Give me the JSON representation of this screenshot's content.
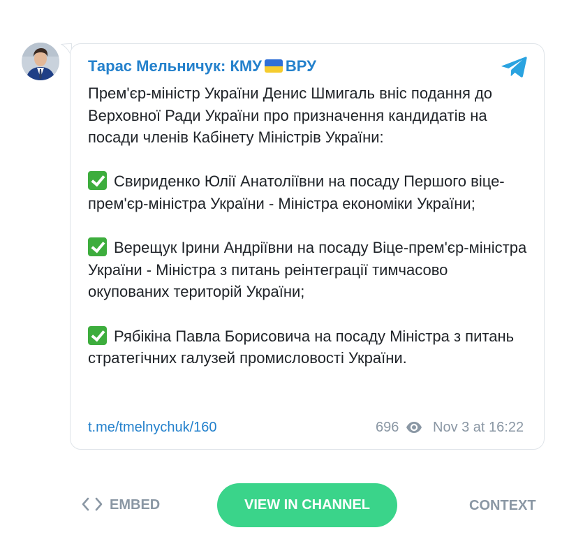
{
  "post": {
    "channel_name_part1": "Тарас Мельничук: КМУ",
    "channel_name_part2": "ВРУ",
    "flag_icon": "ukraine-flag-icon",
    "platform_icon": "telegram-icon",
    "paragraphs": [
      "Прем'єр-міністр України Денис Шмигаль вніс подання до Верховної Ради України про призначення кандидатів на посади членів Кабінету Міністрів України:",
      "Свириденко Юлії Анатоліївни на посаду Першого віце-прем'єр-міністра України - Міністра економіки України;",
      "Верещук Ірини Андріївни на посаду Віце-прем'єр-міністра України - Міністра з питань реінтеграції тимчасово окупованих територій України;",
      "Рябікіна Павла Борисовича на посаду Міністра з питань стратегічних галузей промисловості України."
    ],
    "link": "t.me/tmelnychuk/160",
    "views": "696",
    "date": "Nov 3 at 16:22"
  },
  "actions": {
    "embed_label": "EMBED",
    "view_label": "VIEW IN CHANNEL",
    "context_label": "CONTEXT"
  },
  "colors": {
    "accent": "#2481cc",
    "button": "#3ad48a",
    "muted": "#8a97a4",
    "check": "#3dad3d"
  }
}
